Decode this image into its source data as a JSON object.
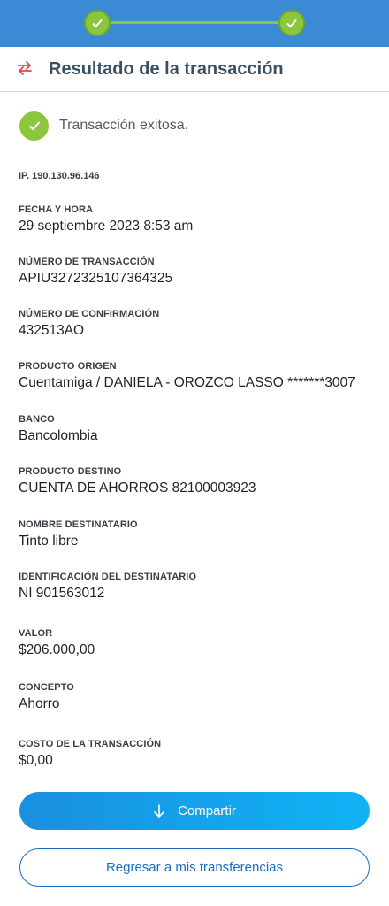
{
  "stepper": {
    "steps": [
      {
        "state": "complete",
        "icon": "check-icon"
      },
      {
        "state": "complete",
        "icon": "check-icon"
      }
    ],
    "colors": {
      "bar": "#3a8ad6",
      "step": "#8cc63f"
    }
  },
  "header": {
    "icon": "transfer-arrows-icon",
    "title": "Resultado de la transacción"
  },
  "status": {
    "icon": "check-circle-icon",
    "message": "Transacción exitosa."
  },
  "ip": "IP. 190.130.96.146",
  "details": [
    {
      "label": "FECHA Y HORA",
      "value": "29 septiembre 2023 8:53 am"
    },
    {
      "label": "NÚMERO DE TRANSACCIÓN",
      "value": "APIU3272325107364325"
    },
    {
      "label": "NÚMERO DE CONFIRMACIÓN",
      "value": "432513AO"
    },
    {
      "label": "PRODUCTO ORIGEN",
      "value": "Cuentamiga / DANIELA - OROZCO LASSO *******3007"
    },
    {
      "label": "BANCO",
      "value": "Bancolombia"
    },
    {
      "label": "PRODUCTO DESTINO",
      "value": "CUENTA DE AHORROS 82100003923"
    },
    {
      "label": "NOMBRE DESTINATARIO",
      "value": "Tinto libre"
    },
    {
      "label": "IDENTIFICACIÓN DEL DESTINATARIO",
      "value": "NI 901563012"
    },
    {
      "label": "VALOR",
      "value": "$206.000,00"
    },
    {
      "label": "CONCEPTO",
      "value": "Ahorro"
    },
    {
      "label": "COSTO DE LA TRANSACCIÓN",
      "value": "$0,00"
    }
  ],
  "actions": {
    "share_label": "Compartir",
    "share_icon": "arrow-down-icon",
    "back_label": "Regresar a mis transferencias"
  },
  "colors": {
    "accent": "#1a8fe0",
    "success": "#8cc63f",
    "title": "#3b4f63"
  }
}
